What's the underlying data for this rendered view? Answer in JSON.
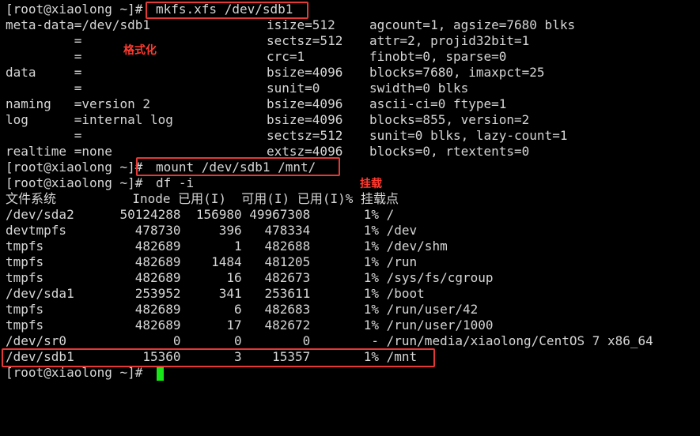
{
  "terminal": {
    "prompt": "[root@xiaolong ~]# ",
    "cmd_mkfs": "mkfs.xfs /dev/sdb1",
    "meta": [
      [
        "meta-data=/dev/sdb1",
        "isize=512",
        "agcount=1, agsize=7680 blks"
      ],
      [
        "         =",
        "sectsz=512",
        "attr=2, projid32bit=1"
      ],
      [
        "         =",
        "crc=1",
        "finobt=0, sparse=0"
      ],
      [
        "data     =",
        "bsize=4096",
        "blocks=7680, imaxpct=25"
      ],
      [
        "         =",
        "sunit=0",
        "swidth=0 blks"
      ],
      [
        "naming   =version 2",
        "bsize=4096",
        "ascii-ci=0 ftype=1"
      ],
      [
        "log      =internal log",
        "bsize=4096",
        "blocks=855, version=2"
      ],
      [
        "         =",
        "sectsz=512",
        "sunit=0 blks, lazy-count=1"
      ],
      [
        "realtime =none",
        "extsz=4096",
        "blocks=0, rtextents=0"
      ]
    ],
    "cmd_mount": "mount /dev/sdb1 /mnt/",
    "cmd_df": "df -i",
    "df_header": "文件系统          Inode 已用(I)  可用(I) 已用(I)% 挂载点",
    "df_rows": [
      "/dev/sda2      50124288  156980 49967308       1% /",
      "devtmpfs         478730     396   478334       1% /dev",
      "tmpfs            482689       1   482688       1% /dev/shm",
      "tmpfs            482689    1484   481205       1% /run",
      "tmpfs            482689      16   482673       1% /sys/fs/cgroup",
      "/dev/sda1        253952     341   253611       1% /boot",
      "tmpfs            482689       6   482683       1% /run/user/42",
      "tmpfs            482689      17   482672       1% /run/user/1000",
      "/dev/sr0              0       0        0        - /run/media/xiaolong/CentOS 7 x86_64",
      "/dev/sdb1         15360       3    15357       1% /mnt"
    ],
    "last_prompt": "[root@xiaolong ~]# "
  },
  "annotations": {
    "format_label": "格式化",
    "mount_label": "挂载",
    "box_color": "#e53935"
  }
}
